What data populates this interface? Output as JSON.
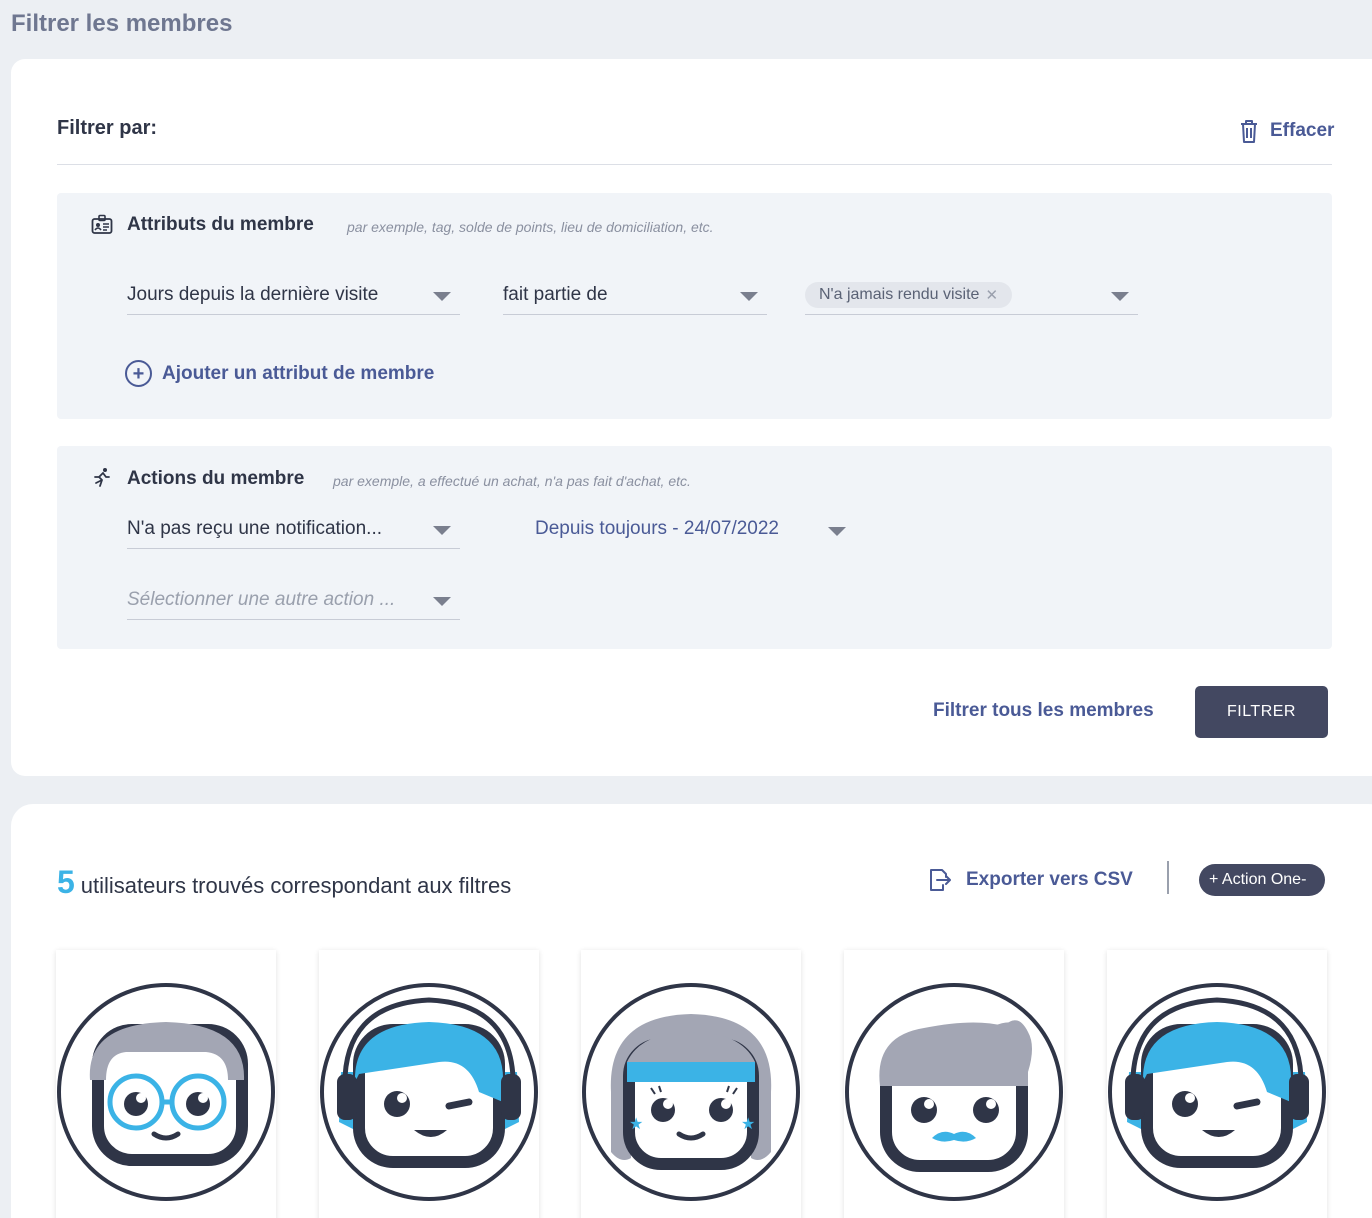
{
  "page_title": "Filtrer les membres",
  "filter_bar": {
    "label": "Filtrer par:",
    "clear_label": "Effacer"
  },
  "attributes_section": {
    "title": "Attributs du membre",
    "hint": "par exemple, tag, solde de points, lieu de domiciliation, etc.",
    "attribute_select": "Jours depuis la dernière visite",
    "operator_select": "fait partie de",
    "value_chip": "N'a jamais rendu visite",
    "add_label": "Ajouter un attribut de membre"
  },
  "actions_section": {
    "title": "Actions du membre",
    "hint": "par exemple, a effectué un achat, n'a pas fait d'achat, etc.",
    "action_select": "N'a pas reçu une notification...",
    "date_range": "Depuis toujours - 24/07/2022",
    "other_action_placeholder": "Sélectionner une autre action ..."
  },
  "footer": {
    "filter_all_label": "Filtrer tous les membres",
    "filter_button": "FILTRER"
  },
  "results": {
    "count": "5",
    "count_text": "utilisateurs trouvés correspondant aux filtres",
    "export_label": "Exporter vers CSV",
    "action_label": "+ Action One-"
  },
  "members": [
    {
      "avatar": "avatar-glasses-icon"
    },
    {
      "avatar": "avatar-headset-icon"
    },
    {
      "avatar": "avatar-girl-icon"
    },
    {
      "avatar": "avatar-quiff-icon"
    },
    {
      "avatar": "avatar-headset-icon"
    }
  ],
  "colors": {
    "accent": "#3bb3e6",
    "link": "#4a5a96",
    "dark_button": "#434861",
    "hair_gray": "#a3a6b4",
    "outline": "#2f3547"
  }
}
